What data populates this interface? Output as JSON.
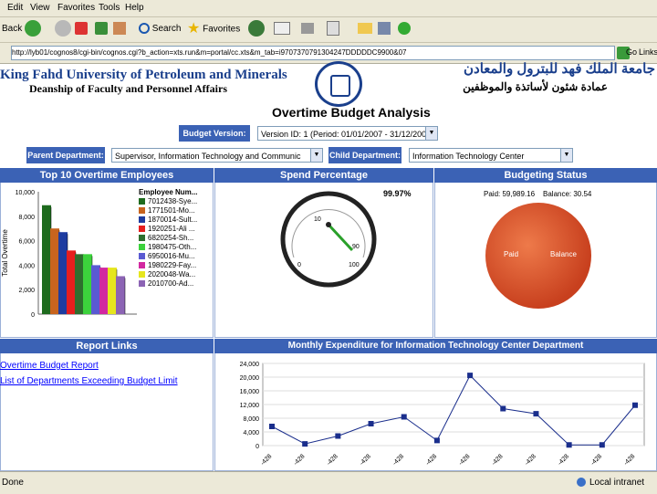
{
  "menu": [
    "Edit",
    "View",
    "Favorites",
    "Tools",
    "Help"
  ],
  "toolbar": {
    "back": "Back",
    "search": "Search",
    "favorites": "Favorites",
    "go": "Go",
    "links": "Links"
  },
  "address": {
    "url": "http://lyb01/cognos8/cgi-bin/cognos.cgi?b_action=xts.run&m=portal/cc.xts&m_tab=i9707370791304247DDDDDC9900&07"
  },
  "header": {
    "university_en": "King Fahd University of Petroleum and Minerals",
    "deanship_en": "Deanship of Faculty and Personnel Affairs",
    "university_ar": "جامعة الملك فهد للبترول والمعادن",
    "deanship_ar": "عمادة شئون لأساتذة والموظفين",
    "report_title": "Overtime Budget Analysis"
  },
  "filters": {
    "budget_version_label": "Budget Version:",
    "budget_version_value": "Version ID: 1 (Period: 01/01/2007 - 31/12/2007)",
    "parent_dept_label": "Parent Department:",
    "parent_dept_value": "Supervisor, Information Technology and Communic",
    "child_dept_label": "Child Department:",
    "child_dept_value": "Information Technology Center"
  },
  "panels": {
    "top10": "Top 10 Overtime Employees",
    "spend": "Spend Percentage",
    "status": "Budgeting Status",
    "links": "Report Links",
    "monthly": "Monthly Expenditure for Information Technology Center Department"
  },
  "links": [
    "Overtime Budget Report",
    "List of Departments Exceeding Budget Limit"
  ],
  "spend_value": "99.97%",
  "status_text": {
    "paid": "Paid: 59,989.16",
    "balance": "Balance: 30.54",
    "paid_label": "Paid",
    "balance_label": "Balance"
  },
  "status_bar": {
    "left": "Done",
    "zone": "Local intranet"
  },
  "chart_data": [
    {
      "type": "bar",
      "title": "Top 10 Overtime Employees",
      "ylabel": "Total Overtime",
      "ylim": [
        0,
        10000
      ],
      "yticks": [
        "10,000",
        "8,000",
        "6,000",
        "4,000",
        "2,000",
        "0"
      ],
      "legend_title": "Employee Num...",
      "series": [
        {
          "name": "7012438-Sye...",
          "value": 8900,
          "color": "#1e6b1e"
        },
        {
          "name": "1771501-Mo...",
          "value": 7000,
          "color": "#c8641e"
        },
        {
          "name": "1870014-Sult...",
          "value": 6700,
          "color": "#1e3ca0"
        },
        {
          "name": "1920251-Ali ...",
          "value": 5200,
          "color": "#e61e1e"
        },
        {
          "name": "6820254-Sh...",
          "value": 4900,
          "color": "#2e6e2e"
        },
        {
          "name": "1980475-Oth...",
          "value": 4900,
          "color": "#3cd23c"
        },
        {
          "name": "6950016-Mu...",
          "value": 4000,
          "color": "#5a5ad2"
        },
        {
          "name": "1980229-Fay...",
          "value": 3800,
          "color": "#d228a0"
        },
        {
          "name": "2020048-Wa...",
          "value": 3800,
          "color": "#e6e61e"
        },
        {
          "name": "2010700-Ad...",
          "value": 3100,
          "color": "#8c64b4"
        }
      ]
    },
    {
      "type": "gauge",
      "title": "Spend Percentage",
      "value": 99.97,
      "ticks": [
        "0",
        "10",
        "50",
        "90",
        "100"
      ]
    },
    {
      "type": "pie",
      "title": "Budgeting Status",
      "slices": [
        {
          "label": "Paid",
          "value": 59989.16,
          "color": "#d9532b"
        },
        {
          "label": "Balance",
          "value": 30.54,
          "color": "#e07a3a"
        }
      ]
    },
    {
      "type": "line",
      "title": "Monthly Expenditure for Information Technology Center Department",
      "ylim": [
        0,
        24000
      ],
      "yticks": [
        "24,000",
        "20,000",
        "16,000",
        "12,000",
        "8,000",
        "4,000",
        "0"
      ],
      "x": [
        "-428",
        "-428",
        "-428",
        "-428",
        "-428",
        "-428",
        "-428",
        "-428",
        "-428",
        "-428",
        "-428",
        "-428"
      ],
      "values": [
        5600,
        500,
        2800,
        6400,
        8400,
        1500,
        20500,
        10800,
        9300,
        200,
        200,
        11800
      ],
      "color": "#1a2e8c"
    }
  ]
}
